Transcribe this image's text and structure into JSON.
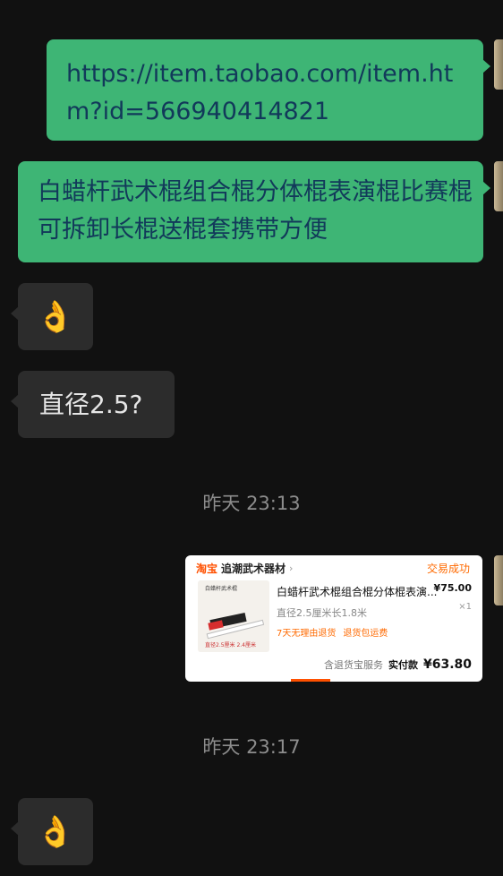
{
  "messages": {
    "link": "https://item.taobao.com/item.htm?id=566940414821",
    "product_title": "白蜡杆武术棍组合棍分体棍表演棍比赛棍可拆卸长棍送棍套携带方便",
    "ok_emoji_1": "👌",
    "question": "直径2.5?",
    "ok_emoji_2": "👌"
  },
  "timestamps": {
    "first": "昨天 23:13",
    "second": "昨天 23:17"
  },
  "order_card": {
    "platform": "淘宝",
    "shop_name": "追潮武术器材",
    "status": "交易成功",
    "thumb_title": "白蜡杆武术棍",
    "thumb_caption": "直径2.5厘米  2.4厘米",
    "item_title": "白蜡杆武术棍组合棍分体棍表演...",
    "price": "¥75.00",
    "quantity": "×1",
    "spec": "直径2.5厘米长1.8米",
    "tag_return": "7天无理由退货",
    "tag_shipping": "退货包运费",
    "service": "含退货宝服务",
    "paid_label": "实付款",
    "paid_amount": "¥63.80"
  },
  "colors": {
    "background": "#111111",
    "outgoing_bubble": "#3eb575",
    "incoming_bubble": "#2c2c2c",
    "accent": "#ff5000"
  }
}
